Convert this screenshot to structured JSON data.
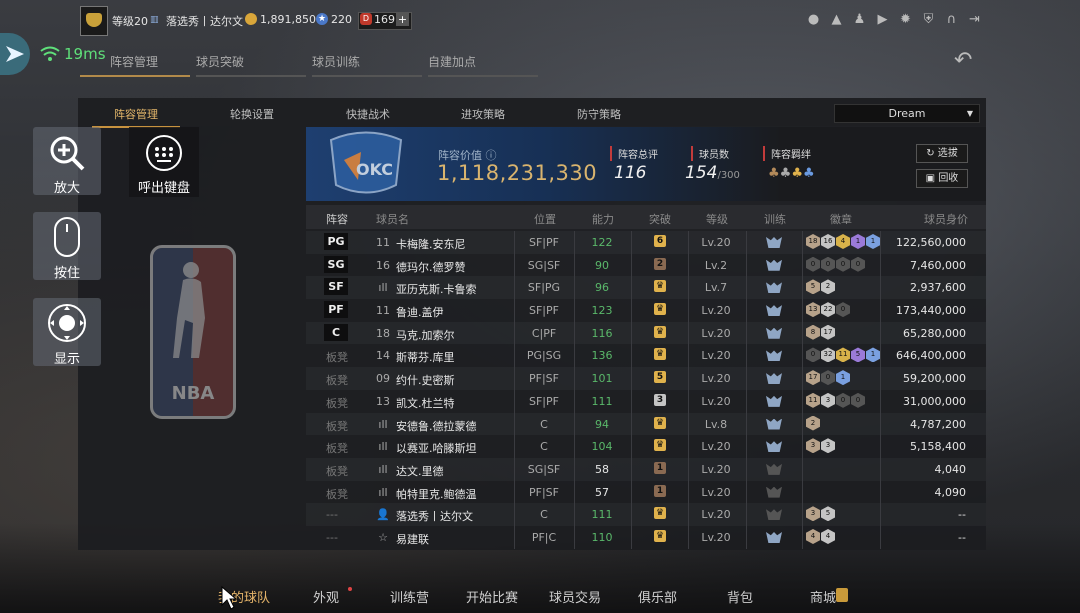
{
  "topbar": {
    "level": "等级20",
    "player_rank": "落选秀丨达尔文",
    "coins": "1,891,850",
    "stars": "220",
    "tickets": "169",
    "icons": [
      "profile-icon",
      "bell-icon",
      "friends-icon",
      "video-icon",
      "gear-icon",
      "shield-icon",
      "headset-icon",
      "exit-icon"
    ]
  },
  "network": {
    "ping": "19ms"
  },
  "top_tabs": [
    "阵容管理",
    "球员突破",
    "球员训练",
    "自建加点"
  ],
  "sub_tabs": [
    "阵容管理",
    "轮换设置",
    "快捷战术",
    "进攻策略",
    "防守策略"
  ],
  "dropdown": {
    "value": "Dream"
  },
  "banner": {
    "value_label": "阵容价值",
    "value": "1,118,231,330",
    "rating_label": "阵容总评",
    "rating": "116",
    "players_label": "球员数",
    "players": "154",
    "players_max": "/300",
    "bond_label": "阵容羁绊",
    "btn_pick": "选拔",
    "btn_recycle": "回收"
  },
  "table": {
    "headers": [
      "阵容",
      "球员名",
      "位置",
      "能力",
      "突破",
      "等级",
      "训练",
      "徽章",
      "球员身价"
    ],
    "rows": [
      {
        "slot": "PG",
        "starter": true,
        "num": "11",
        "name": "卡梅隆.安东尼",
        "pos": "SF|PF",
        "ovr": "122",
        "brk": "6",
        "brk_color": "#e0b24c",
        "lv": "Lv.20",
        "train": true,
        "badges": [
          [
            "18",
            "#b7a28a"
          ],
          [
            "16",
            "#c4c4c4"
          ],
          [
            "4",
            "#d8b24a"
          ],
          [
            "1",
            "#9a7ad8"
          ],
          [
            "1",
            "#7aa0e0"
          ]
        ],
        "price": "122,560,000"
      },
      {
        "slot": "SG",
        "starter": true,
        "num": "16",
        "name": "德玛尔.德罗赞",
        "pos": "SG|SF",
        "ovr": "90",
        "brk": "2",
        "brk_color": "#8a6a52",
        "lv": "Lv.2",
        "train": true,
        "badges": [
          [
            "0",
            "#555"
          ],
          [
            "0",
            "#555"
          ],
          [
            "0",
            "#555"
          ],
          [
            "0",
            "#555"
          ]
        ],
        "price": "7,460,000"
      },
      {
        "slot": "SF",
        "starter": true,
        "num": "ıll",
        "name": "亚历克斯.卡鲁索",
        "pos": "SF|PG",
        "ovr": "96",
        "brk": "♛",
        "brk_color": "#e0b24c",
        "lv": "Lv.7",
        "train": true,
        "badges": [
          [
            "5",
            "#b7a28a"
          ],
          [
            "2",
            "#c4c4c4"
          ]
        ],
        "price": "2,937,600"
      },
      {
        "slot": "PF",
        "starter": true,
        "num": "11",
        "name": "鲁迪.盖伊",
        "pos": "SF|PF",
        "ovr": "123",
        "brk": "♛",
        "brk_color": "#e0b24c",
        "lv": "Lv.20",
        "train": true,
        "badges": [
          [
            "13",
            "#b7a28a"
          ],
          [
            "22",
            "#c4c4c4"
          ],
          [
            "0",
            "#555"
          ]
        ],
        "price": "173,440,000"
      },
      {
        "slot": "C",
        "starter": true,
        "num": "18",
        "name": "马克.加索尔",
        "pos": "C|PF",
        "ovr": "116",
        "brk": "♛",
        "brk_color": "#e0b24c",
        "lv": "Lv.20",
        "train": true,
        "badges": [
          [
            "8",
            "#b7a28a"
          ],
          [
            "17",
            "#c4c4c4"
          ]
        ],
        "price": "65,280,000"
      },
      {
        "slot": "板凳",
        "starter": false,
        "num": "14",
        "name": "斯蒂芬.库里",
        "pos": "PG|SG",
        "ovr": "136",
        "brk": "♛",
        "brk_color": "#e0b24c",
        "lv": "Lv.20",
        "train": true,
        "badges": [
          [
            "0",
            "#555"
          ],
          [
            "32",
            "#c4c4c4"
          ],
          [
            "11",
            "#d8b24a"
          ],
          [
            "5",
            "#9a7ad8"
          ],
          [
            "1",
            "#7aa0e0"
          ]
        ],
        "price": "646,400,000"
      },
      {
        "slot": "板凳",
        "starter": false,
        "num": "09",
        "name": "约什.史密斯",
        "pos": "PF|SF",
        "ovr": "101",
        "brk": "5",
        "brk_color": "#e0b24c",
        "lv": "Lv.20",
        "train": true,
        "badges": [
          [
            "17",
            "#b7a28a"
          ],
          [
            "0",
            "#555"
          ],
          [
            "1",
            "#7aa0e0"
          ]
        ],
        "price": "59,200,000"
      },
      {
        "slot": "板凳",
        "starter": false,
        "num": "13",
        "name": "凯文.杜兰特",
        "pos": "SF|PF",
        "ovr": "111",
        "brk": "3",
        "brk_color": "#c4c4c4",
        "lv": "Lv.20",
        "train": true,
        "badges": [
          [
            "11",
            "#b7a28a"
          ],
          [
            "3",
            "#c4c4c4"
          ],
          [
            "0",
            "#555"
          ],
          [
            "0",
            "#555"
          ]
        ],
        "price": "31,000,000"
      },
      {
        "slot": "板凳",
        "starter": false,
        "num": "ıll",
        "name": "安德鲁.德拉蒙德",
        "pos": "C",
        "ovr": "94",
        "brk": "♛",
        "brk_color": "#e0b24c",
        "lv": "Lv.8",
        "train": true,
        "badges": [
          [
            "2",
            "#b7a28a"
          ]
        ],
        "price": "4,787,200"
      },
      {
        "slot": "板凳",
        "starter": false,
        "num": "ıll",
        "name": "以赛亚.哈滕斯坦",
        "pos": "C",
        "ovr": "104",
        "brk": "♛",
        "brk_color": "#e0b24c",
        "lv": "Lv.20",
        "train": true,
        "badges": [
          [
            "3",
            "#b7a28a"
          ],
          [
            "3",
            "#c4c4c4"
          ]
        ],
        "price": "5,158,400"
      },
      {
        "slot": "板凳",
        "starter": false,
        "num": "ıll",
        "name": "达文.里德",
        "pos": "SG|SF",
        "ovr": "58",
        "brk": "1",
        "brk_color": "#8a6a52",
        "lv": "Lv.20",
        "train": false,
        "badges": [],
        "price": "4,040"
      },
      {
        "slot": "板凳",
        "starter": false,
        "num": "ıll",
        "name": "帕特里克.鲍德温",
        "pos": "PF|SF",
        "ovr": "57",
        "brk": "1",
        "brk_color": "#8a6a52",
        "lv": "Lv.20",
        "train": false,
        "badges": [],
        "price": "4,090"
      },
      {
        "slot": "---",
        "starter": false,
        "num": "👤",
        "name": "落选秀丨达尔文",
        "pos": "C",
        "ovr": "111",
        "brk": "♛",
        "brk_color": "#e0b24c",
        "lv": "Lv.20",
        "train": false,
        "badges": [
          [
            "3",
            "#b7a28a"
          ],
          [
            "5",
            "#c4c4c4"
          ]
        ],
        "price": "--"
      },
      {
        "slot": "---",
        "starter": false,
        "num": "☆",
        "name": "易建联",
        "pos": "PF|C",
        "ovr": "110",
        "brk": "♛",
        "brk_color": "#e0b24c",
        "lv": "Lv.20",
        "train": true,
        "badges": [
          [
            "4",
            "#b7a28a"
          ],
          [
            "4",
            "#c4c4c4"
          ]
        ],
        "price": "--"
      }
    ]
  },
  "left_buttons": {
    "zoom": "放大",
    "keyboard": "呼出键盘",
    "press": "按住",
    "show": "显示"
  },
  "bottom_nav": [
    "我的球队",
    "外观",
    "训练营",
    "开始比赛",
    "球员交易",
    "俱乐部",
    "背包",
    "商城"
  ],
  "colors": {
    "accent": "#c7923f",
    "ability_green": "#5ab86a",
    "gold": "#d9b46e"
  }
}
